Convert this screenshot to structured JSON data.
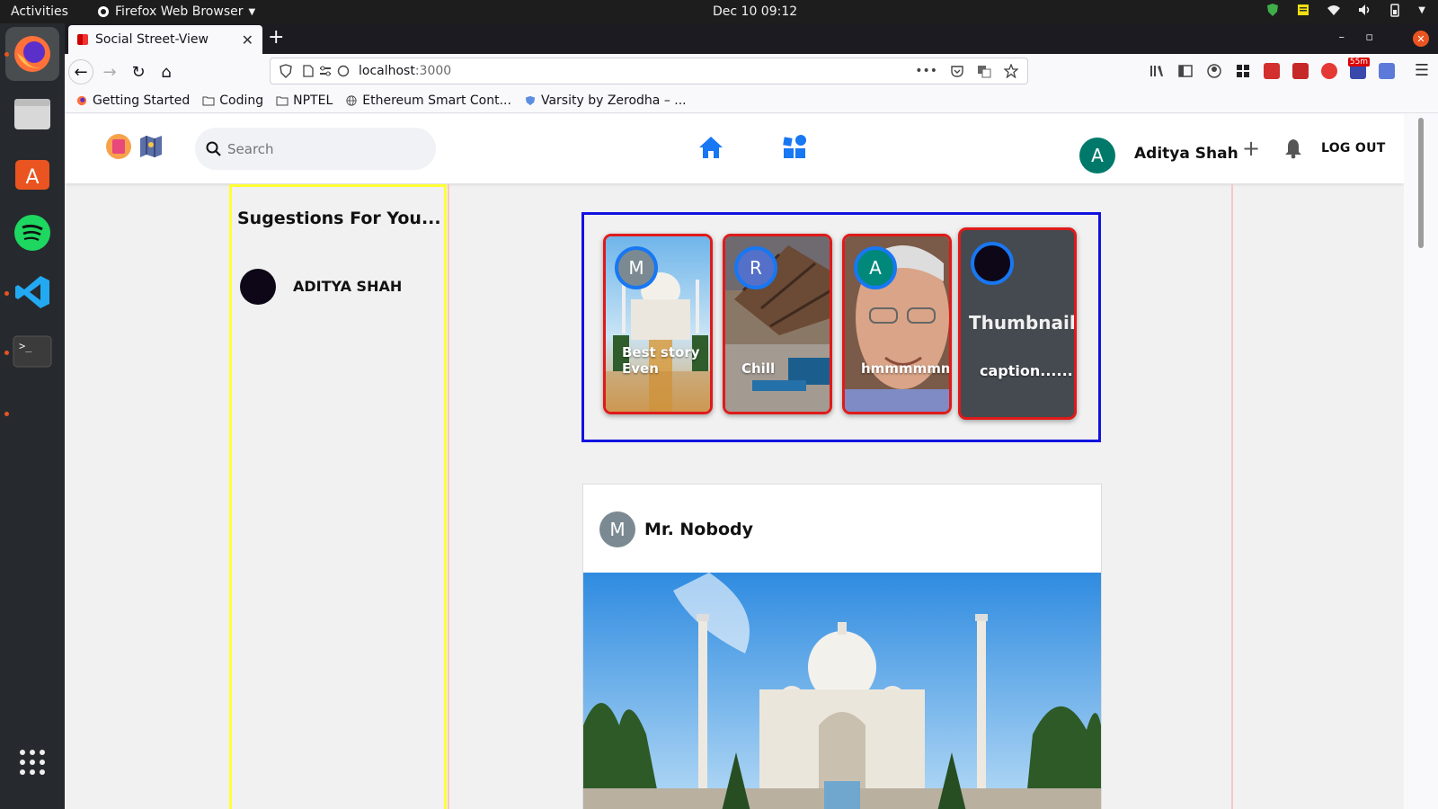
{
  "topbar": {
    "activities": "Activities",
    "app_menu": "Firefox Web Browser",
    "clock": "Dec 10  09:12"
  },
  "browser": {
    "tab_title": "Social Street-View",
    "url_host": "localhost",
    "url_port": ":3000",
    "badge": "55m",
    "bookmarks": [
      {
        "label": "Getting Started",
        "icon": "firefox-icon"
      },
      {
        "label": "Coding",
        "icon": "folder-icon"
      },
      {
        "label": "NPTEL",
        "icon": "folder-icon"
      },
      {
        "label": "Ethereum Smart Cont...",
        "icon": "globe-icon"
      },
      {
        "label": "Varsity by Zerodha – ...",
        "icon": "shield-icon"
      }
    ]
  },
  "app": {
    "search_placeholder": "Search",
    "user_initial": "A",
    "user_name": "Aditya Shah",
    "logout": "LOG OUT",
    "accent": "#1877f2"
  },
  "sidebar": {
    "title": "Sugestions For You...",
    "suggestions": [
      {
        "name": "ADITYA SHAH"
      }
    ]
  },
  "stories": [
    {
      "initial": "M",
      "caption": "Best story Even",
      "bg": "taj"
    },
    {
      "initial": "R",
      "caption": "Chill",
      "bg": "beach"
    },
    {
      "initial": "A",
      "caption": "hmmmmmm",
      "bg": "face"
    },
    {
      "initial": "",
      "title": "Thumbnail",
      "caption": "caption......",
      "bg": "placeholder"
    }
  ],
  "post": {
    "author_initial": "M",
    "author": "Mr. Nobody"
  }
}
